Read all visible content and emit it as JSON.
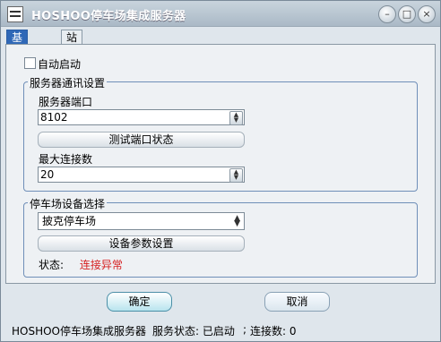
{
  "window": {
    "title": "HOSHOO停车场集成服务器"
  },
  "window_controls": {
    "minimize": "–",
    "restore": "□",
    "close": "×"
  },
  "tabs": [
    {
      "label": "基本设置",
      "active": true
    },
    {
      "label": "站点管理",
      "active": false
    }
  ],
  "auto_start": {
    "label": "自动启动",
    "checked": false
  },
  "server_comm": {
    "title": "服务器通讯设置",
    "port_label": "服务器端口",
    "port_value": "8102",
    "test_button": "测试端口状态",
    "max_conn_label": "最大连接数",
    "max_conn_value": "20"
  },
  "parking_device": {
    "title": "停车场设备选择",
    "selected_device": "披克停车场",
    "params_button": "设备参数设置",
    "status_label": "状态:",
    "status_value": "连接异常",
    "status_color": "#d62020"
  },
  "buttons": {
    "ok": "确定",
    "cancel": "取消"
  },
  "statusbar": {
    "app_name": "HOSHOO停车场集成服务器",
    "sep1": ";",
    "service_state": "服务状态: 已启动",
    "sep2": ";",
    "connections": "连接数: 0"
  }
}
